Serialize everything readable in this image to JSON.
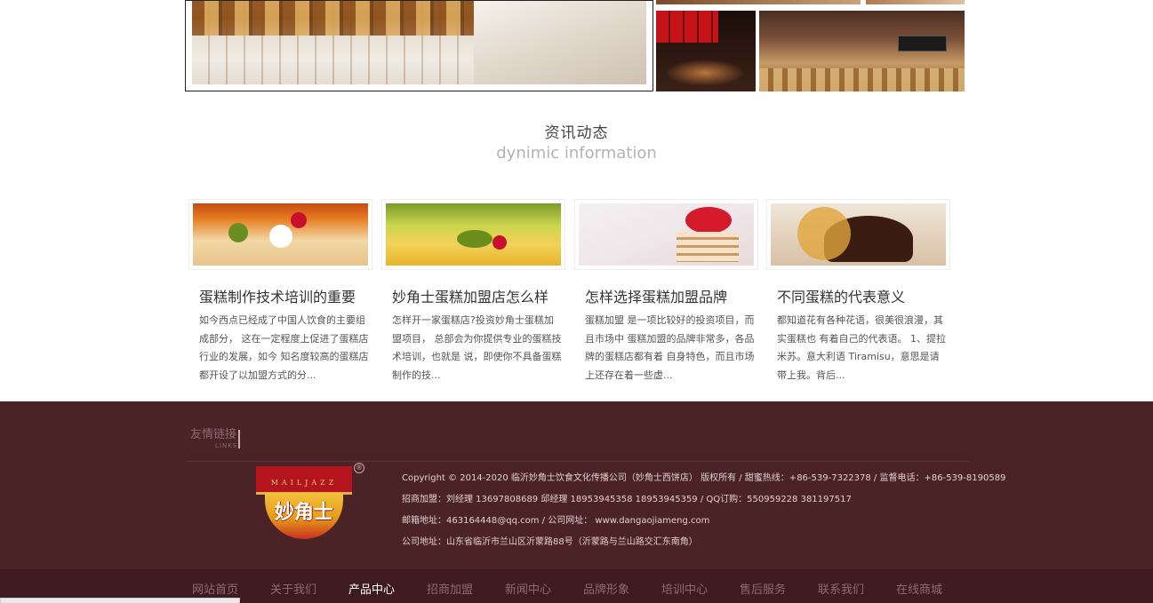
{
  "section": {
    "title_cn": "资讯动态",
    "title_en": "dynimic information"
  },
  "news": [
    {
      "title": "蛋糕制作技术培训的重要",
      "desc": "如今西点已经成了中国人饮食的主要组成部分， 这在一定程度上促进了蛋糕店行业的发展，如今 知名度较高的蛋糕店都开设了以加盟方式的分..."
    },
    {
      "title": "妙角士蛋糕加盟店怎么样",
      "desc": "怎样开一家蛋糕店?投资妙角士蛋糕加盟项目， 总部会为你提供专业的蛋糕技术培训，也就是 说，即使你不具备蛋糕制作的技..."
    },
    {
      "title": "怎样选择蛋糕加盟品牌",
      "desc": "蛋糕加盟 是一项比较好的投资项目，而且市场中 蛋糕加盟的品牌非常多，各品牌的蛋糕店都有着 自身特色，而且市场上还存在着一些虚..."
    },
    {
      "title": "不同蛋糕的代表意义",
      "desc": "都知道花有各种花语，很美很浪漫，其实蛋糕也 有着自己的代表语。 1、提拉米苏。意大利语 Tiramisu，意思是请带上我。背后..."
    }
  ],
  "footer": {
    "links_title": "友情链接",
    "links_sub": "LINKS",
    "logo": {
      "brand_en": "MAILJAZZ",
      "brand_cn": "妙角士",
      "reg": "®"
    },
    "copyright": "Copyright © 2014-2020 临沂妙角士饮食文化传播公司（妙角士西饼店） 版权所有 / 甜蜜热线：+86-539-7322378 / 监督电话：+86-539-8190589",
    "contacts": "招商加盟：刘经理 13697808689 邱经理 18953945358 18953945359 / QQ订购：550959228 381197517",
    "email": "邮箱地址：463164448@qq.com / 公司网址： www.dangaojiameng.com",
    "address": "公司地址：山东省临沂市兰山区沂蒙路88号（沂蒙路与兰山路交汇东南角）"
  },
  "nav": [
    {
      "label": "网站首页",
      "active": false
    },
    {
      "label": "关于我们",
      "active": false
    },
    {
      "label": "产品中心",
      "active": true
    },
    {
      "label": "招商加盟",
      "active": false
    },
    {
      "label": "新闻中心",
      "active": false
    },
    {
      "label": "品牌形象",
      "active": false
    },
    {
      "label": "培训中心",
      "active": false
    },
    {
      "label": "售后服务",
      "active": false
    },
    {
      "label": "联系我们",
      "active": false
    },
    {
      "label": "在线商城",
      "active": false
    }
  ]
}
